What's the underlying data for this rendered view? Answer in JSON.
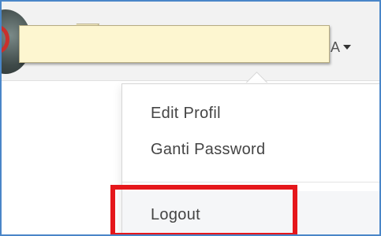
{
  "header": {
    "user_name_suffix": "A",
    "caret_icon": "caret-down-icon",
    "avatar_icon": "user-avatar"
  },
  "callout": {
    "text": ""
  },
  "menu": {
    "items": [
      {
        "label": "Edit Profil"
      },
      {
        "label": "Ganti Password"
      },
      {
        "label": "Logout"
      }
    ]
  },
  "highlight": {
    "color": "#e5171b",
    "target": "Logout"
  }
}
